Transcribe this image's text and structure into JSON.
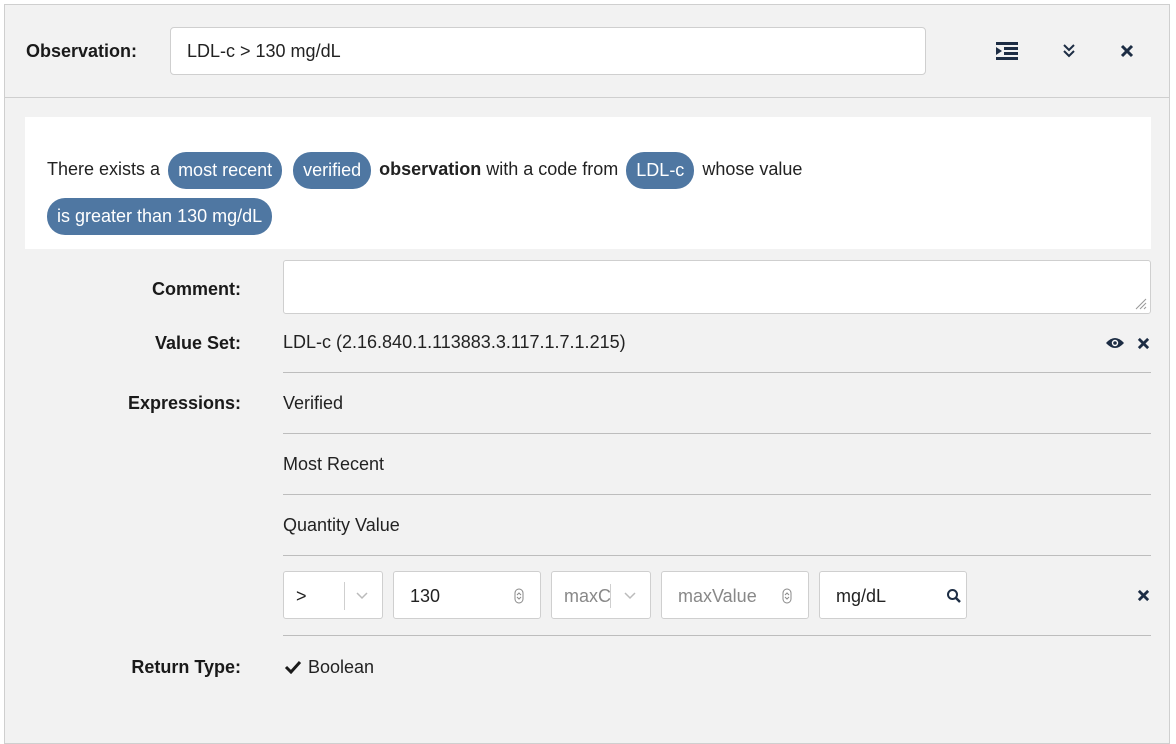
{
  "header": {
    "label": "Observation:",
    "title_value": "LDL-c > 130 mg/dL",
    "icons": [
      "outdent-icon",
      "double-chevron-down-icon",
      "close-icon"
    ]
  },
  "summary": {
    "prefix": "There exists a",
    "pill_most_recent": "most recent",
    "pill_verified": "verified",
    "bold_word": "observation",
    "mid_text": "with a code from",
    "pill_code": "LDL-c",
    "suffix": "whose value",
    "pill_value": "is greater than 130 mg/dL"
  },
  "comment": {
    "label": "Comment:",
    "value": ""
  },
  "value_set": {
    "label": "Value Set:",
    "value": "LDL-c (2.16.840.1.113883.3.117.1.7.1.215)",
    "icons": [
      "eye-icon",
      "close-icon"
    ]
  },
  "expressions": {
    "label": "Expressions:",
    "items": [
      "Verified",
      "Most Recent",
      "Quantity Value"
    ]
  },
  "quantity": {
    "operator": ">",
    "min_value": "130",
    "max_operator_placeholder": "maxC",
    "max_value_placeholder": "maxValue",
    "unit": "mg/dL"
  },
  "return_type": {
    "label": "Return Type:",
    "value": "Boolean",
    "icon": "check-icon"
  },
  "colors": {
    "pill": "#4f77a2",
    "panel": "#f2f2f2",
    "icon": "#1d2d44"
  }
}
